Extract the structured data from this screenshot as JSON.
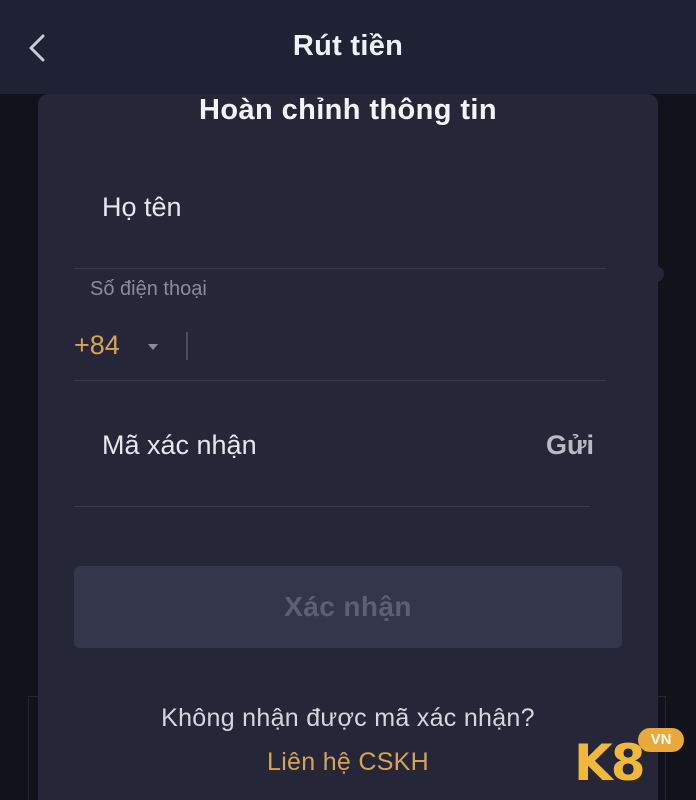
{
  "header": {
    "title": "Rút tiền",
    "back_icon": "chevron-left-icon"
  },
  "modal": {
    "title": "Hoàn chỉnh thông tin",
    "full_name": {
      "label": "Họ tên",
      "value": ""
    },
    "phone": {
      "hint": "Số điện thoại",
      "country_code": "+84",
      "dropdown_icon": "caret-down-icon",
      "value": ""
    },
    "verification": {
      "label": "Mã xác nhận",
      "send_label": "Gửi"
    },
    "confirm_label": "Xác nhận",
    "help_text": "Không nhận được mã xác nhận?",
    "contact_label": "Liên hệ CSKH"
  },
  "watermark": {
    "logo_text": "K8",
    "badge_text": "VN"
  },
  "colors": {
    "accent": "#d6a256",
    "modal_bg": "#252739",
    "header_bg": "#1f2134",
    "button_disabled": "#34364b",
    "logo": "#f0b93c"
  }
}
